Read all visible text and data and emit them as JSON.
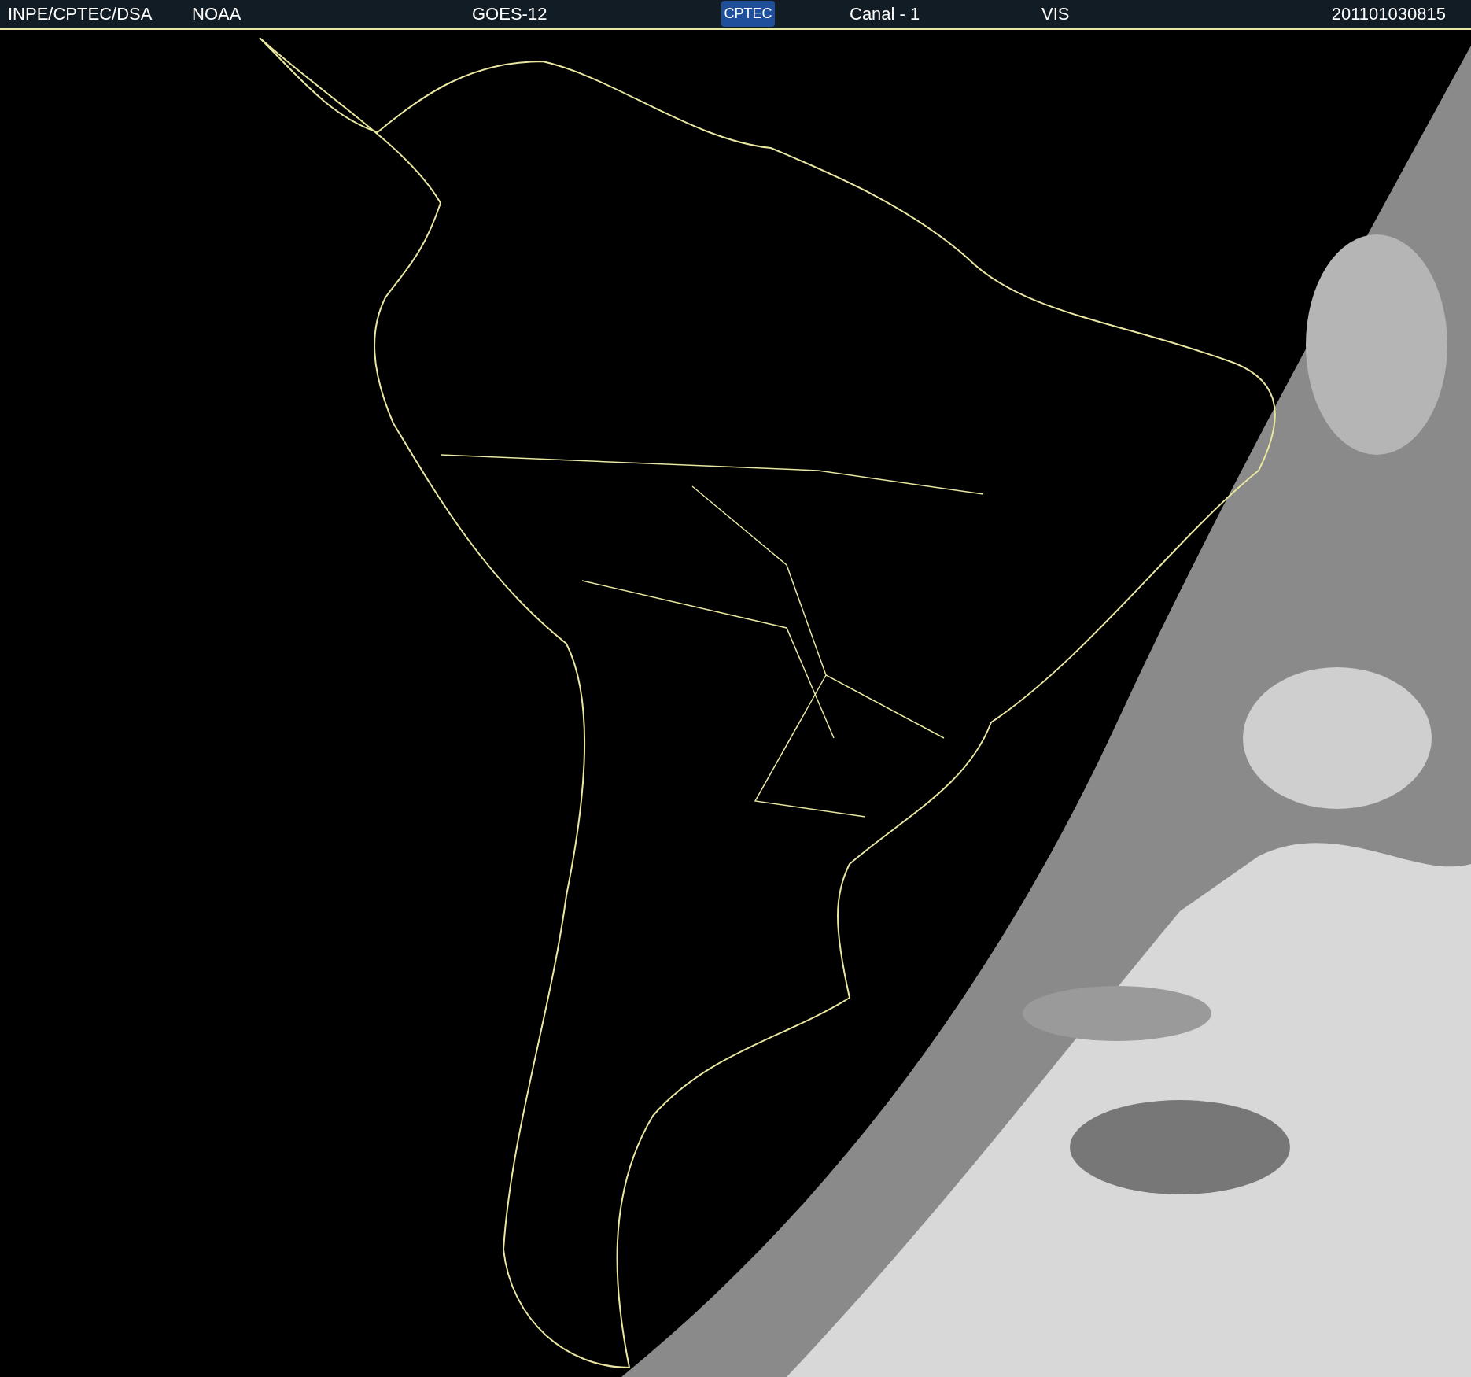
{
  "header": {
    "source": "INPE/CPTEC/DSA",
    "agency": "NOAA",
    "satellite": "GOES-12",
    "logo": "CPTEC",
    "channel": "Canal - 1",
    "band": "VIS",
    "timestamp": "201101030815"
  }
}
